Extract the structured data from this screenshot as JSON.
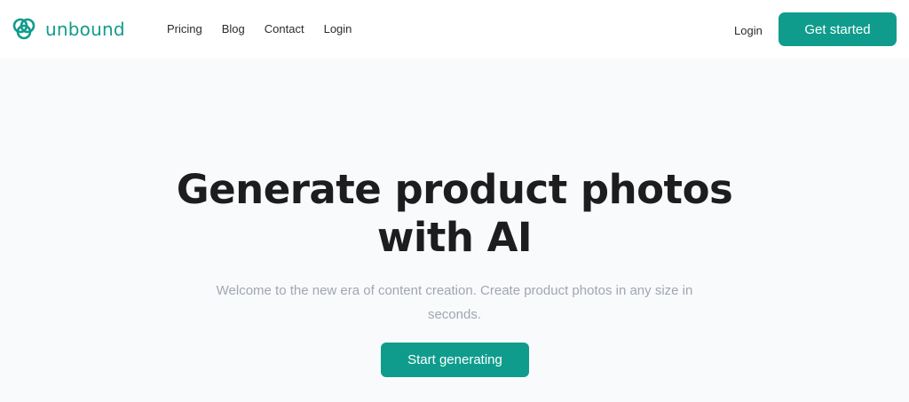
{
  "brand": {
    "name": "unbound",
    "logo_icon": "interlocking-rings-icon",
    "color": "#109c8c"
  },
  "nav": {
    "items": [
      {
        "label": "Pricing"
      },
      {
        "label": "Blog"
      },
      {
        "label": "Contact"
      },
      {
        "label": "Login"
      }
    ]
  },
  "header_actions": {
    "login_label": "Login",
    "get_started_label": "Get started"
  },
  "hero": {
    "title_line1": "Generate product photos",
    "title_line2": "with AI",
    "subtitle_line1": "Welcome to the new era of content creation. Create product photos in any size in",
    "subtitle_line2": "seconds.",
    "cta_label": "Start generating"
  },
  "colors": {
    "accent": "#109c8c",
    "background": "#f9fafc",
    "header_background": "#ffffff",
    "subtitle_text": "#a0a6b1"
  }
}
